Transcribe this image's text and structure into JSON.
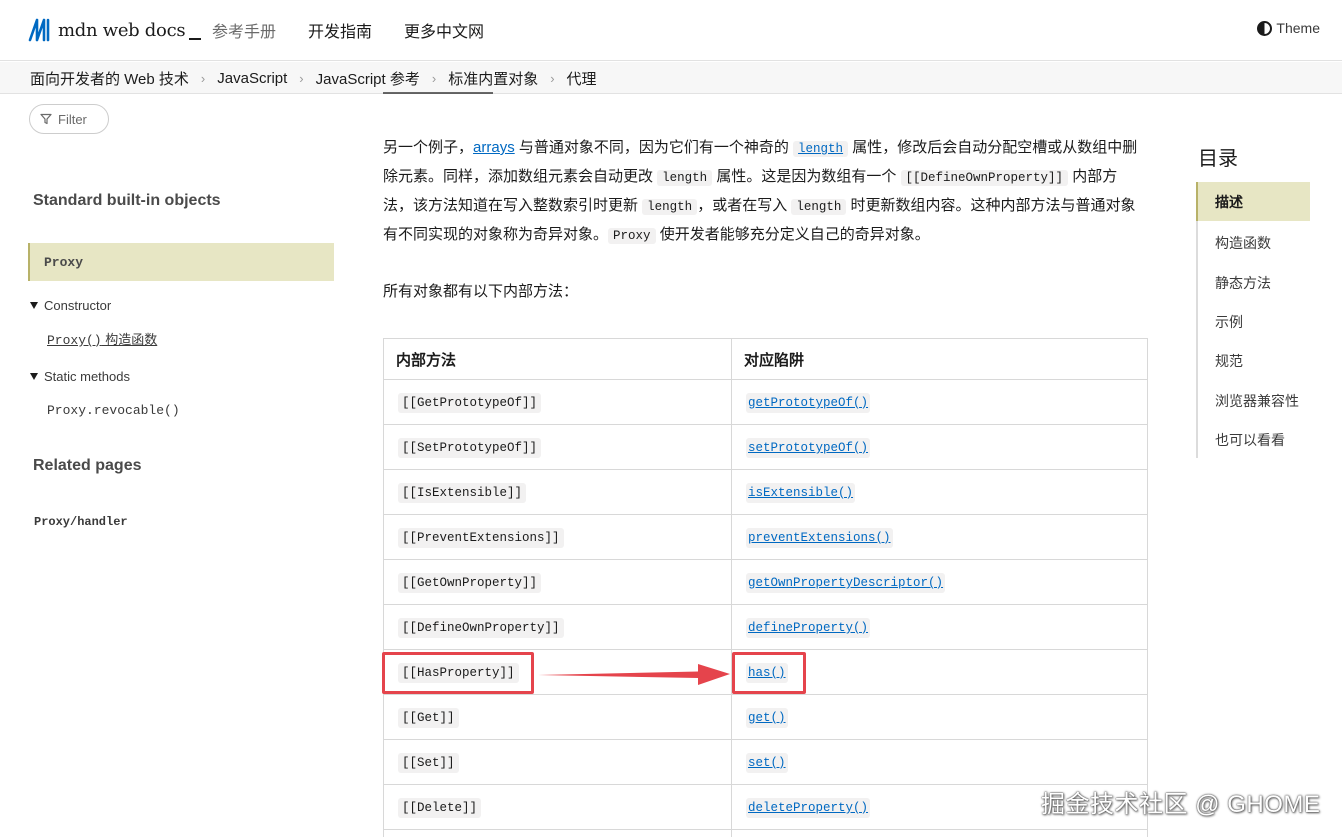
{
  "header": {
    "logo_text": "mdn web docs",
    "nav": [
      "参考手册",
      "开发指南",
      "更多中文网"
    ],
    "theme_label": "Theme"
  },
  "breadcrumb": [
    "面向开发者的 Web 技术",
    "JavaScript",
    "JavaScript 参考",
    "标准内置对象",
    "代理"
  ],
  "sidebar": {
    "filter_label": "Filter",
    "section_title": "Standard built-in objects",
    "active_item": "Proxy",
    "constructor_group": "Constructor",
    "constructor_code": "Proxy()",
    "constructor_text": " 构造函数",
    "static_group": "Static methods",
    "static_item": "Proxy.revocable()",
    "related_title": "Related pages",
    "related_item": "Proxy/handler"
  },
  "article": {
    "p1": {
      "t1": "另一个例子，",
      "link": "arrays",
      "t2": " 与普通对象不同，因为它们有一个神奇的 ",
      "c1": "length",
      "t3": " 属性，修改后会自动分配空槽或从数组中删除元素。同样，添加数组元素会自动更改 ",
      "c2": "length",
      "t4": " 属性。这是因为数组有一个 ",
      "c3": "[[DefineOwnProperty]]",
      "t5": " 内部方法，该方法知道在写入整数索引时更新 ",
      "c4": "length",
      "t6": "，或者在写入 ",
      "c5": "length",
      "t7": " 时更新数组内容。这种内部方法与普通对象有不同实现的对象称为奇异对象。",
      "c6": "Proxy",
      "t8": " 使开发者能够充分定义自己的奇异对象。"
    },
    "p2": "所有对象都有以下内部方法："
  },
  "table": {
    "headers": [
      "内部方法",
      "对应陷阱"
    ],
    "rows": [
      [
        "[[GetPrototypeOf]]",
        "getPrototypeOf()"
      ],
      [
        "[[SetPrototypeOf]]",
        "setPrototypeOf()"
      ],
      [
        "[[IsExtensible]]",
        "isExtensible()"
      ],
      [
        "[[PreventExtensions]]",
        "preventExtensions()"
      ],
      [
        "[[GetOwnProperty]]",
        "getOwnPropertyDescriptor()"
      ],
      [
        "[[DefineOwnProperty]]",
        "defineProperty()"
      ],
      [
        "[[HasProperty]]",
        "has()"
      ],
      [
        "[[Get]]",
        "get()"
      ],
      [
        "[[Set]]",
        "set()"
      ],
      [
        "[[Delete]]",
        "deleteProperty()"
      ]
    ]
  },
  "toc": {
    "title": "目录",
    "items": [
      "描述",
      "构造函数",
      "静态方法",
      "示例",
      "规范",
      "浏览器兼容性",
      "也可以看看"
    ]
  },
  "watermark": "掘金技术社区 @ GHOME",
  "colors": {
    "link": "#0069c2",
    "active_bg": "#e7e6c4",
    "annotation_red": "#e5444c"
  }
}
